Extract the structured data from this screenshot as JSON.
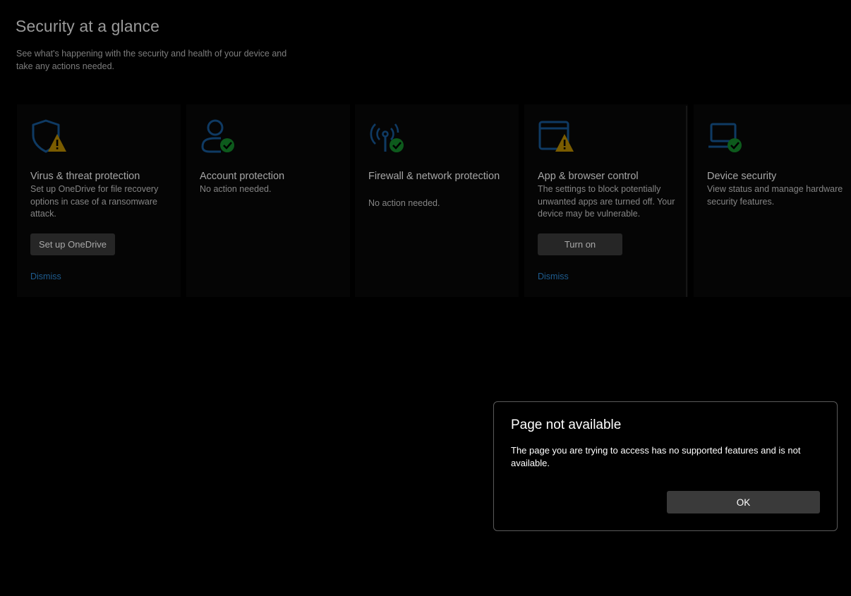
{
  "header": {
    "title": "Security at a glance",
    "subtitle": "See what's happening with the security and health of your device and take any actions needed."
  },
  "cards": [
    {
      "title": "Virus & threat protection",
      "description": "Set up OneDrive for file recovery options in case of a ransomware attack.",
      "button": "Set up OneDrive",
      "link": "Dismiss",
      "icon": "shield-warning-icon",
      "status": "warning"
    },
    {
      "title": "Account protection",
      "description": "No action needed.",
      "icon": "account-check-icon",
      "status": "ok"
    },
    {
      "title": "Firewall & network protection",
      "description": "No action needed.",
      "icon": "antenna-check-icon",
      "status": "ok"
    },
    {
      "title": "App & browser control",
      "description": "The settings to block potentially unwanted apps are turned off. Your device may be vulnerable.",
      "button": "Turn on",
      "link": "Dismiss",
      "icon": "browser-warning-icon",
      "status": "warning"
    },
    {
      "title": "Device security",
      "description": "View status and manage hardware security features.",
      "icon": "laptop-check-icon",
      "status": "ok"
    }
  ],
  "dialog": {
    "title": "Page not available",
    "message": "The page you are trying to access has no supported features and is not available.",
    "ok_button": "OK"
  },
  "colors": {
    "accent_blue": "#0f3a63",
    "warning_yellow": "#7a5c00",
    "ok_green": "#0d5a1c"
  }
}
